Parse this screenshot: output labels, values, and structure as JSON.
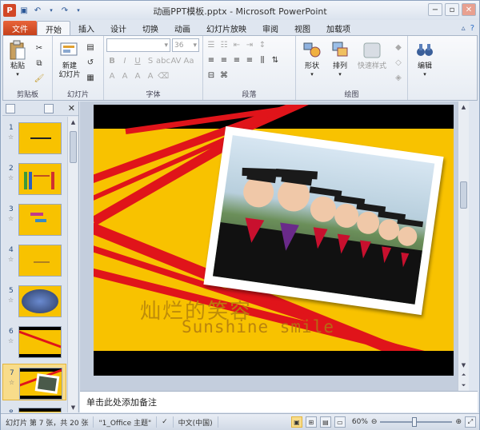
{
  "window": {
    "title": "动画PPT模板.pptx - Microsoft PowerPoint",
    "app_icon": "P"
  },
  "ribbon_tabs": [
    {
      "label": "文件"
    },
    {
      "label": "开始"
    },
    {
      "label": "插入"
    },
    {
      "label": "设计"
    },
    {
      "label": "切换"
    },
    {
      "label": "动画"
    },
    {
      "label": "幻灯片放映"
    },
    {
      "label": "审阅"
    },
    {
      "label": "视图"
    },
    {
      "label": "加载项"
    }
  ],
  "ribbon": {
    "clipboard": {
      "paste_label": "粘贴",
      "group_label": "剪贴板"
    },
    "slides": {
      "new_slide_label": "新建\n幻灯片",
      "group_label": "幻灯片"
    },
    "font": {
      "size_value": "36",
      "group_label": "字体"
    },
    "paragraph": {
      "group_label": "段落"
    },
    "drawing": {
      "shape_label": "形状",
      "arrange_label": "排列",
      "quick_styles_label": "快速样式",
      "group_label": "绘图"
    },
    "editing": {
      "edit_label": "编辑"
    }
  },
  "slides": {
    "count": 8,
    "selected": 7,
    "thumbnails": [
      {
        "num": "1"
      },
      {
        "num": "2"
      },
      {
        "num": "3"
      },
      {
        "num": "4"
      },
      {
        "num": "5"
      },
      {
        "num": "6"
      },
      {
        "num": "7"
      },
      {
        "num": "8"
      }
    ]
  },
  "slide": {
    "cn_title": "灿烂的笑容",
    "en_title": "Sunshine smile"
  },
  "notes": {
    "placeholder": "单击此处添加备注"
  },
  "status": {
    "slide_info": "幻灯片 第 7 张，共 20 张",
    "theme": "\"1_Office 主题\"",
    "language": "中文(中国)",
    "zoom": "60%"
  },
  "colors": {
    "slide_bg": "#f8c200",
    "stripe_red": "#e0141a",
    "file_tab": "#d24726"
  }
}
